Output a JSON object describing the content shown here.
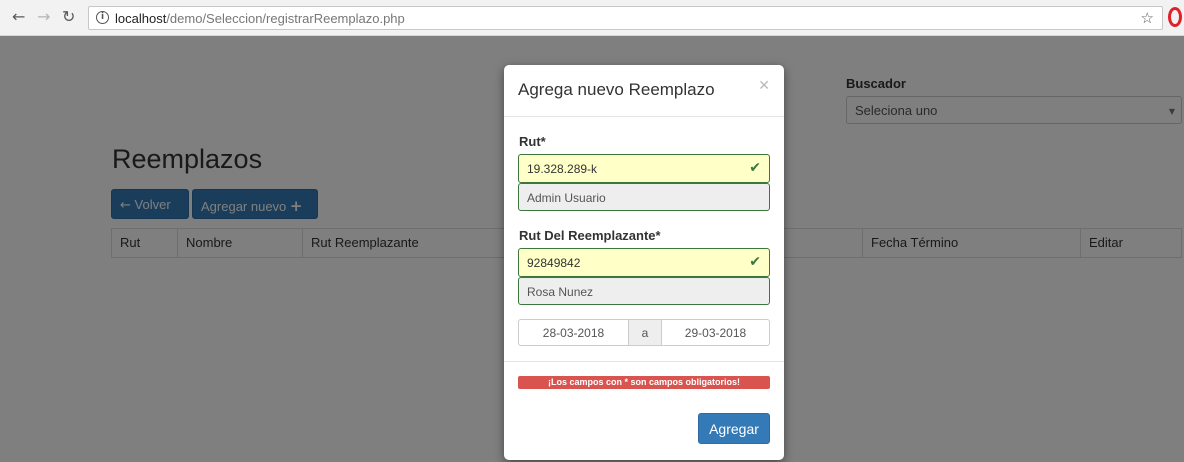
{
  "browser": {
    "url_host": "localhost",
    "url_path": "/demo/Seleccion/registrarReemplazo.php"
  },
  "page": {
    "buscador_label": "Buscador",
    "buscador_select_value": "Seleciona uno",
    "title": "Reemplazos",
    "btn_volver": "Volver",
    "btn_agregar_nuevo": "Agregar nuevo",
    "table_headers": [
      "Rut",
      "Nombre",
      "Rut Reemplazante",
      "Fecha Término",
      "Editar"
    ]
  },
  "modal": {
    "title": "Agrega nuevo Reemplazo",
    "rut_label": "Rut*",
    "rut_value": "19.328.289-k",
    "rut_name": "Admin Usuario",
    "rut_reemplazante_label": "Rut Del Reemplazante*",
    "rut_reemplazante_value": "92849842",
    "rut_reemplazante_name": "Rosa Nunez",
    "date_from": "28-03-2018",
    "date_separator": "a",
    "date_to": "29-03-2018",
    "required_notice": "¡Los campos con * son campos obligatorios!",
    "submit_label": "Agregar"
  },
  "colors": {
    "primary": "#337ab7",
    "success": "#3c763d",
    "valid_input_bg": "#ffffc8",
    "danger": "#d9534f"
  }
}
